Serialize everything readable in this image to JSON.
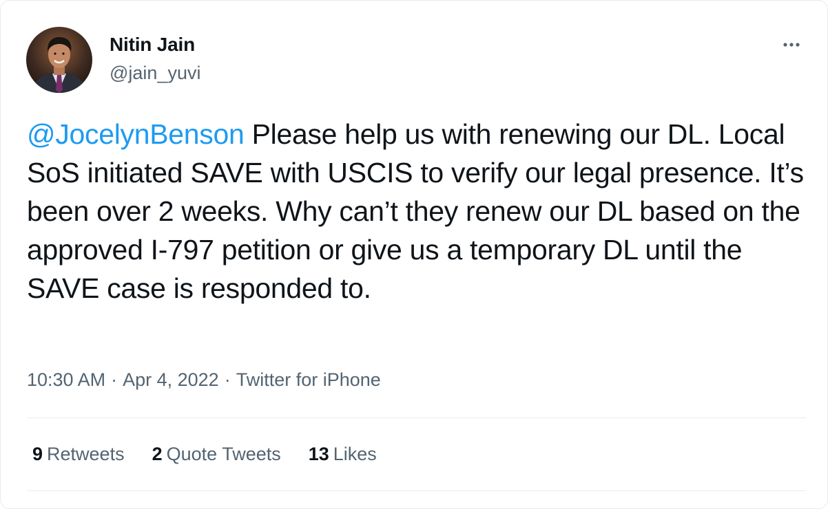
{
  "tweet": {
    "author_name": "Nitin Jain",
    "author_handle": "@jain_yuvi",
    "mention": "@JocelynBenson",
    "text": " Please help us with renewing our DL. Local SoS initiated SAVE with USCIS to verify our legal presence. It’s been over 2 weeks. Why can’t they renew our DL based on the approved I-797 petition or give us a temporary DL until the SAVE case is responded to.",
    "time": "10:30 AM",
    "separator": "·",
    "date": "Apr 4, 2022",
    "source": "Twitter for iPhone"
  },
  "stats": {
    "retweets_count": "9",
    "retweets_label": "Retweets",
    "quotes_count": "2",
    "quotes_label": "Quote Tweets",
    "likes_count": "13",
    "likes_label": "Likes"
  },
  "icons": {
    "avatar": "profile-photo",
    "more": "more-horizontal-icon"
  },
  "colors": {
    "mention": "#1d9bf0",
    "text": "#0f1419",
    "secondary": "#536471",
    "divider": "#e6ecf0"
  }
}
